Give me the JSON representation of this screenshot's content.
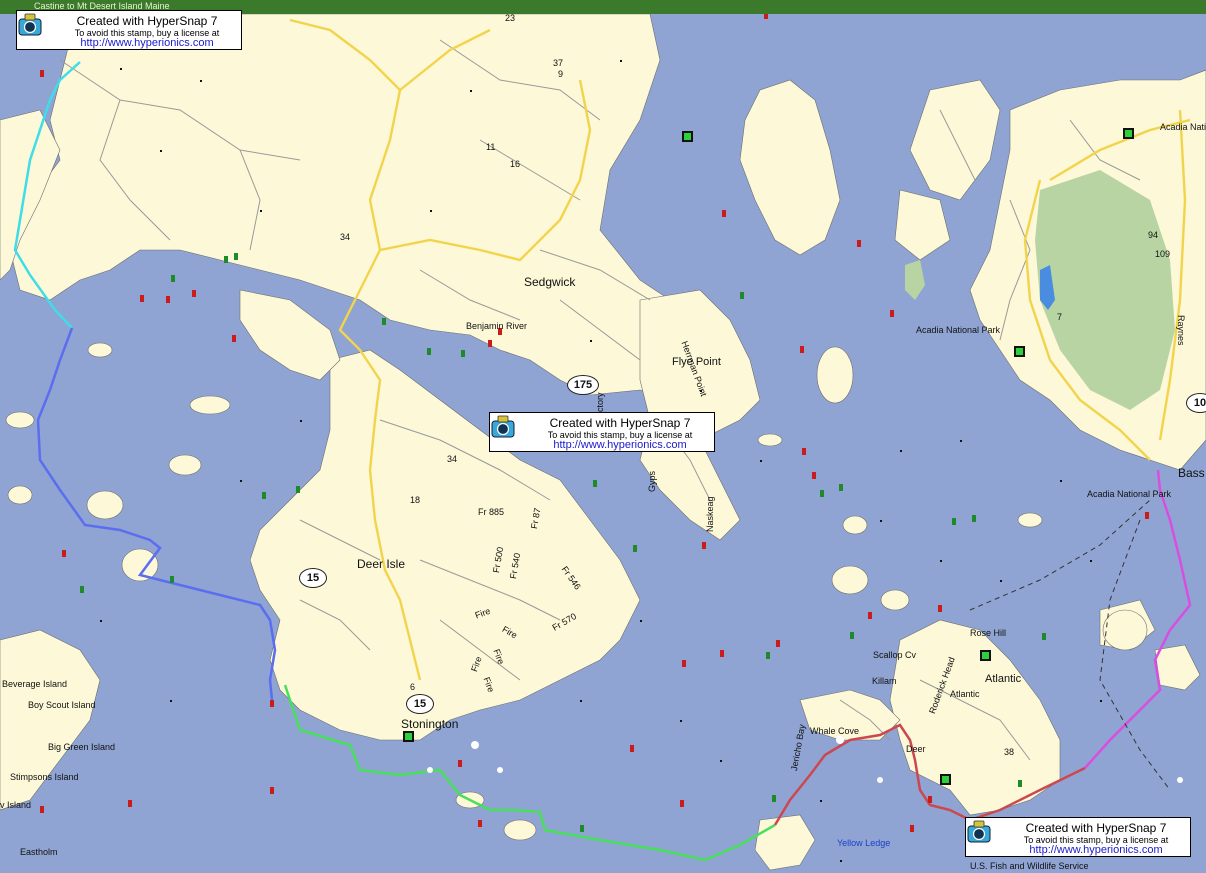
{
  "window": {
    "title": "Castine to Mt Desert Island Maine"
  },
  "stamp": {
    "line1": "Created with HyperSnap 7",
    "line2": "To avoid this stamp, buy a license at",
    "line3": "http://www.hyperionics.com"
  },
  "places": {
    "sedgwick": "Sedgwick",
    "benjamin_river": "Benjamin River",
    "flye_point": "Flye Point",
    "harriman_point": "Herrman Point",
    "deer_isle": "Deer Isle",
    "stonington": "Stonington",
    "acadia_np_1": "Acadia National Park",
    "acadia_np_2": "Acadia National Park",
    "acadia_nat": "Acadia Natio",
    "bass": "Bass",
    "beverage_island": "Beverage Island",
    "boy_scout_island": "Boy Scout Island",
    "big_green_island": "Big Green Island",
    "stimpsons_island": "Stimpsons Island",
    "eastholm": "Eastholm",
    "cow_island": "v Island",
    "whale_cove": "Whale Cove",
    "jericho_bay": "Jericho Bay",
    "killam": "Killam",
    "scallop_cv": "Scallop Cv",
    "rose_hill": "Rose Hill",
    "atlantic_1": "Atlantic",
    "atlantic_2": "Atlantic",
    "roderick_head": "Roderick Head",
    "deer": "Deer",
    "yellow_ledge": "Yellow Ledge",
    "us_fish": "U.S. Fish and Wildlife Service",
    "rayne": "Raynes",
    "naskeag": "Naskeag",
    "gypsum": "Gyps",
    "victory": "ctory"
  },
  "roads": {
    "fr885": "Fr 885",
    "fr87": "Fr 87",
    "fr500": "Fr 500",
    "fr540": "Fr 540",
    "fr546": "Fr 546",
    "fr570": "Fr 570",
    "fire1": "Fire",
    "fire2": "Fire",
    "fire3": "Fire",
    "fire4": "Fire",
    "fire5": "Fire"
  },
  "shields": {
    "r15a": "15",
    "r15b": "15",
    "r175": "175",
    "r10": "10"
  },
  "depths": [
    "23",
    "37",
    "9",
    "11",
    "16",
    "34",
    "34",
    "18",
    "94",
    "109",
    "7",
    "38",
    "6"
  ],
  "colors": {
    "water": "#8fa4d2",
    "land": "#fcf8d8",
    "park": "#b9d4a3",
    "road": "#a3a3a3",
    "highway": "#f2d44c",
    "route_cyan": "#3fdde8",
    "route_blue": "#5b6df0",
    "route_green": "#47e05a",
    "route_red": "#cc4850",
    "route_magenta": "#d94ee0"
  }
}
